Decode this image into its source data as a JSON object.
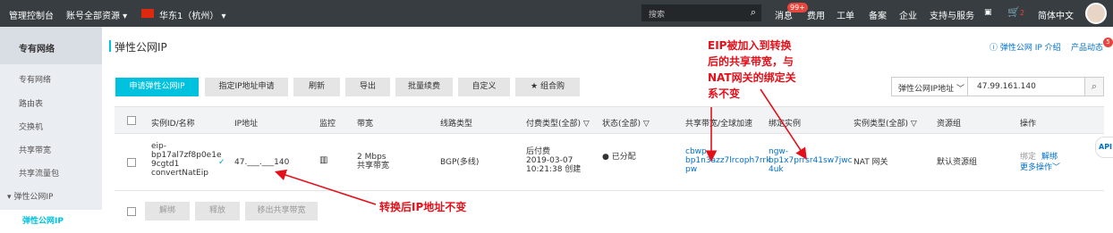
{
  "topbar": {
    "console": "管理控制台",
    "account": "账号全部资源 ▾",
    "region": "华东1（杭州） ▾",
    "search_placeholder": "搜索",
    "message": "消息",
    "message_badge": "99+",
    "billing": "费用",
    "ticket": "工单",
    "record": "备案",
    "enterprise": "企业",
    "support": "支持与服务",
    "cart_count": "2",
    "language": "简体中文"
  },
  "sidebar": {
    "title": "专有网络",
    "items": [
      "专有网络",
      "路由表",
      "交换机",
      "共享带宽",
      "共享流量包",
      "▾ 弹性公网IP",
      "弹性公网IP"
    ]
  },
  "page": {
    "title": "弹性公网IP",
    "help_link": "ⓘ 弹性公网 IP 介绍",
    "news_link": "产品动态",
    "news_badge": "5"
  },
  "toolbar": {
    "apply": "申请弹性公网IP",
    "apply_ip": "指定IP地址申请",
    "refresh": "刷新",
    "export": "导出",
    "renew": "批量续费",
    "custom": "自定义",
    "bundle": "★ 组合购",
    "filter_select": "弹性公网IP地址 ﹀",
    "filter_value": "47.99.161.140"
  },
  "table": {
    "headers": [
      "实例ID/名称",
      "IP地址",
      "监控",
      "带宽",
      "线路类型",
      "付费类型(全部) ▽",
      "状态(全部) ▽",
      "共享带宽/全球加速",
      "绑定实例",
      "实例类型(全部) ▽",
      "资源组",
      "操作"
    ],
    "row": {
      "instance_id": [
        "eip-",
        "bp17al7zf8p0e1e",
        "9cgtd1",
        "convertNatEip"
      ],
      "ip": "47.___.___140",
      "bandwidth": [
        "2 Mbps",
        "共享带宽"
      ],
      "line": "BGP(多线)",
      "billing": [
        "后付费",
        "2019-03-07",
        "10:21:38 创建"
      ],
      "status": "● 已分配",
      "shared_bw": [
        "cbwp-",
        "bp1n3azz7lrcoph7rrk",
        "pw"
      ],
      "bound": [
        "ngw-",
        "bp1x7prrsr41sw7jwc",
        "4uk"
      ],
      "type": "NAT 网关",
      "rg": "默认资源组",
      "ops_bind": "绑定",
      "ops_unbind": "解绑",
      "ops_more": "更多操作﹀"
    }
  },
  "footer_buttons": [
    "解绑",
    "释放",
    "移出共享带宽"
  ],
  "api_tab": "API",
  "annotations": {
    "top": [
      "EIP被加入到转换",
      "后的共享带宽，与",
      "NAT网关的绑定关",
      "系不变"
    ],
    "bottom": "转换后IP地址不变"
  },
  "colors": {
    "accent": "#00c1de",
    "annotation": "#e3101a",
    "link": "#0070cc",
    "topbar": "#373d41"
  }
}
